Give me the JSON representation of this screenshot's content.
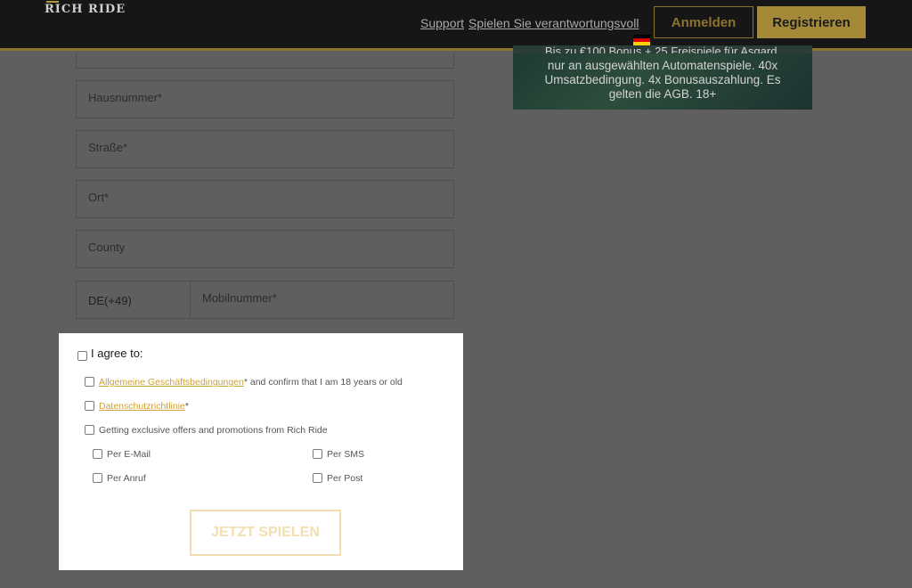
{
  "header": {
    "logo_text": "RICH RIDE",
    "support_label": "Support",
    "responsible_label": "Spielen Sie verantwortungsvoll",
    "login_label": "Anmelden",
    "register_label": "Registrieren",
    "flag_icon": "germany-flag-icon"
  },
  "promo": {
    "top_cut_text": "Bis zu €100 Bonus + 25 Freispiele für Asgard,",
    "lines": [
      "nur an  ausgewählten Automatenspiele. 40x",
      "Umsatzbedingung. 4x Bonusauszahlung. Es",
      "gelten die AGB. 18+"
    ]
  },
  "form": {
    "house_number": "Hausnummer*",
    "street": "Straße*",
    "city": "Ort*",
    "county": "County",
    "phone_code": "DE(+49)",
    "mobile_placeholder": "Mobilnummer*"
  },
  "agreement": {
    "title": "I agree to:",
    "terms_link": "Allgemeine Geschäftsbedingungen",
    "terms_suffix": "* and confirm that I am 18 years or old",
    "privacy_link": "Datenschutzrichtlinie",
    "privacy_suffix": "*",
    "offers_label": "Getting exclusive offers and promotions from Rich Ride",
    "channels": {
      "email": "Per E-Mail",
      "sms": "Per SMS",
      "call": "Per Anruf",
      "post": "Per Post"
    },
    "play_button": "JETZT SPIELEN"
  },
  "colors": {
    "accent_gold": "#a38938",
    "link_gold": "#d0a135",
    "overlay_gray": "#5f5f5f"
  }
}
